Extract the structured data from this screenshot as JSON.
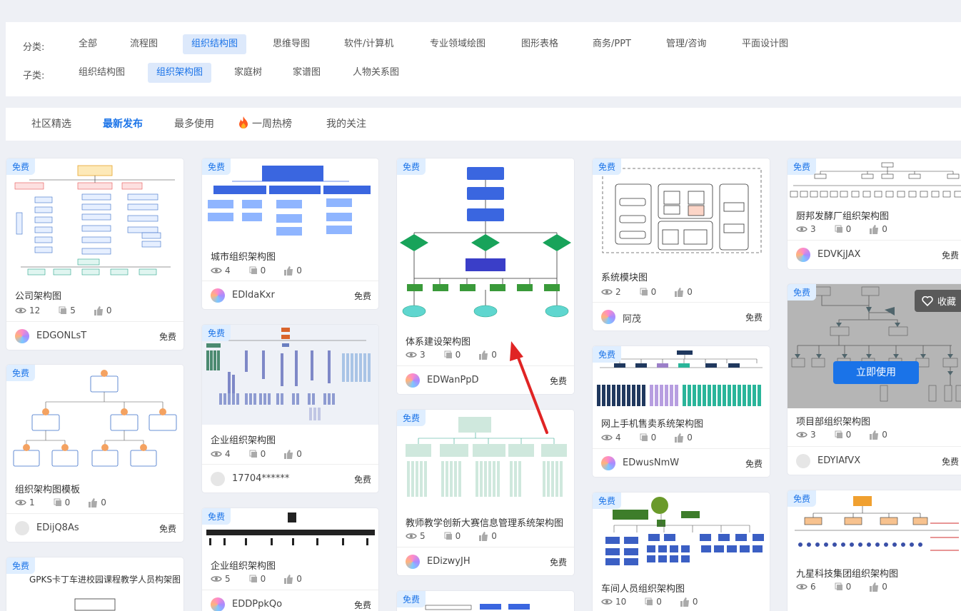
{
  "filter": {
    "category_label": "分类:",
    "categories": [
      "全部",
      "流程图",
      "组织结构图",
      "思维导图",
      "软件/计算机",
      "专业领域绘图",
      "图形表格",
      "商务/PPT",
      "管理/咨询",
      "平面设计图"
    ],
    "active_category": "组织结构图",
    "subcategory_label": "子类:",
    "subcategories": [
      "组织结构图",
      "组织架构图",
      "家庭树",
      "家谱图",
      "人物关系图"
    ],
    "active_subcategory": "组织架构图"
  },
  "tabs": [
    "社区精选",
    "最新发布",
    "最多使用",
    "一周热榜",
    "我的关注"
  ],
  "active_tab": "最新发布",
  "badge_free": "免费",
  "free_label": "免费",
  "hover_card": {
    "favorite_label": "收藏",
    "use_label": "立即使用"
  },
  "cards": [
    {
      "title": "公司架构图",
      "views": "12",
      "comments": "5",
      "likes": "0",
      "user": "EDGONLsT"
    },
    {
      "title": "组织架构图模板",
      "views": "1",
      "comments": "0",
      "likes": "0",
      "user": "EDijQ8As"
    },
    {
      "title": "GPKS卡丁车进校园课程教学人员构架图"
    },
    {
      "title": "城市组织架构图",
      "views": "4",
      "comments": "0",
      "likes": "0",
      "user": "EDIdaKxr"
    },
    {
      "title": "企业组织架构图",
      "views": "4",
      "comments": "0",
      "likes": "0",
      "user": "17704******"
    },
    {
      "title": "企业组织架构图",
      "views": "5",
      "comments": "0",
      "likes": "0",
      "user": "EDDPpkQo"
    },
    {
      "title": "体系建设架构图",
      "views": "3",
      "comments": "0",
      "likes": "0",
      "user": "EDWanPpD"
    },
    {
      "title": "教师教学创新大赛信息管理系统架构图",
      "views": "5",
      "comments": "0",
      "likes": "0",
      "user": "EDizwyJH"
    },
    {
      "title": "系统模块图",
      "views": "2",
      "comments": "0",
      "likes": "0",
      "user": "阿茂"
    },
    {
      "title": "网上手机售卖系统架构图",
      "views": "4",
      "comments": "0",
      "likes": "0",
      "user": "EDwusNmW"
    },
    {
      "title": "车间人员组织架构图",
      "views": "10",
      "comments": "0",
      "likes": "0"
    },
    {
      "title": "厨邦发酵厂组织架构图",
      "views": "3",
      "comments": "0",
      "likes": "0",
      "user": "EDVKjJAX"
    },
    {
      "title": "项目部组织架构图",
      "views": "3",
      "comments": "0",
      "likes": "0",
      "user": "EDYIAfVX"
    },
    {
      "title": "九星科技集团组织架构图",
      "views": "6",
      "comments": "0",
      "likes": "0"
    }
  ],
  "colors": {
    "accent": "#1a73e8",
    "badge_bg": "#dfeeff",
    "arrow": "#e02424",
    "overlay_button": "#1a73e8"
  }
}
